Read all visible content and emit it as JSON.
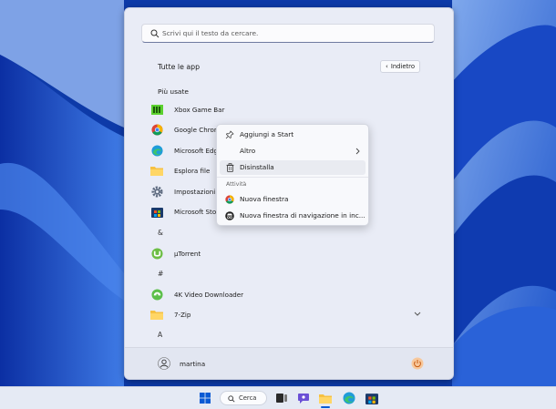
{
  "search": {
    "placeholder": "Scrivi qui il testo da cercare."
  },
  "all_apps": {
    "title": "Tutte le app",
    "back_label": "Indietro"
  },
  "most_used_title": "Più usate",
  "most_used": [
    {
      "label": "Xbox Game Bar",
      "icon": "xbox-game-bar-icon"
    },
    {
      "label": "Google Chrome",
      "icon": "chrome-icon"
    },
    {
      "label": "Microsoft Edge",
      "icon": "edge-icon"
    },
    {
      "label": "Esplora file",
      "icon": "folder-icon"
    },
    {
      "label": "Impostazioni",
      "icon": "gear-icon"
    },
    {
      "label": "Microsoft Store",
      "icon": "store-icon"
    }
  ],
  "groups": [
    {
      "letter": "&"
    },
    {
      "label": "µTorrent",
      "icon": "utorrent-icon"
    },
    {
      "letter": "#"
    },
    {
      "label": "4K Video Downloader",
      "icon": "4k-downloader-icon"
    },
    {
      "label": "7-Zip",
      "icon": "folder-icon"
    },
    {
      "letter": "A"
    }
  ],
  "context_menu": {
    "items": [
      {
        "label": "Aggiungi a Start",
        "icon": "pin-icon"
      },
      {
        "label": "Altro",
        "icon": "chevron-right-icon"
      },
      {
        "label": "Disinstalla",
        "icon": "trash-icon"
      }
    ],
    "section_label": "Attività",
    "tasks": [
      {
        "label": "Nuova finestra",
        "icon": "chrome-icon"
      },
      {
        "label": "Nuova finestra di navigazione in inc...",
        "icon": "incognito-icon"
      }
    ]
  },
  "user": {
    "name": "martina"
  },
  "taskbar": {
    "search_label": "Cerca"
  },
  "colors": {
    "accent": "#0a5ad4",
    "wallpaper": "#0a3fb4",
    "menu_bg": "#e9ecf6"
  }
}
